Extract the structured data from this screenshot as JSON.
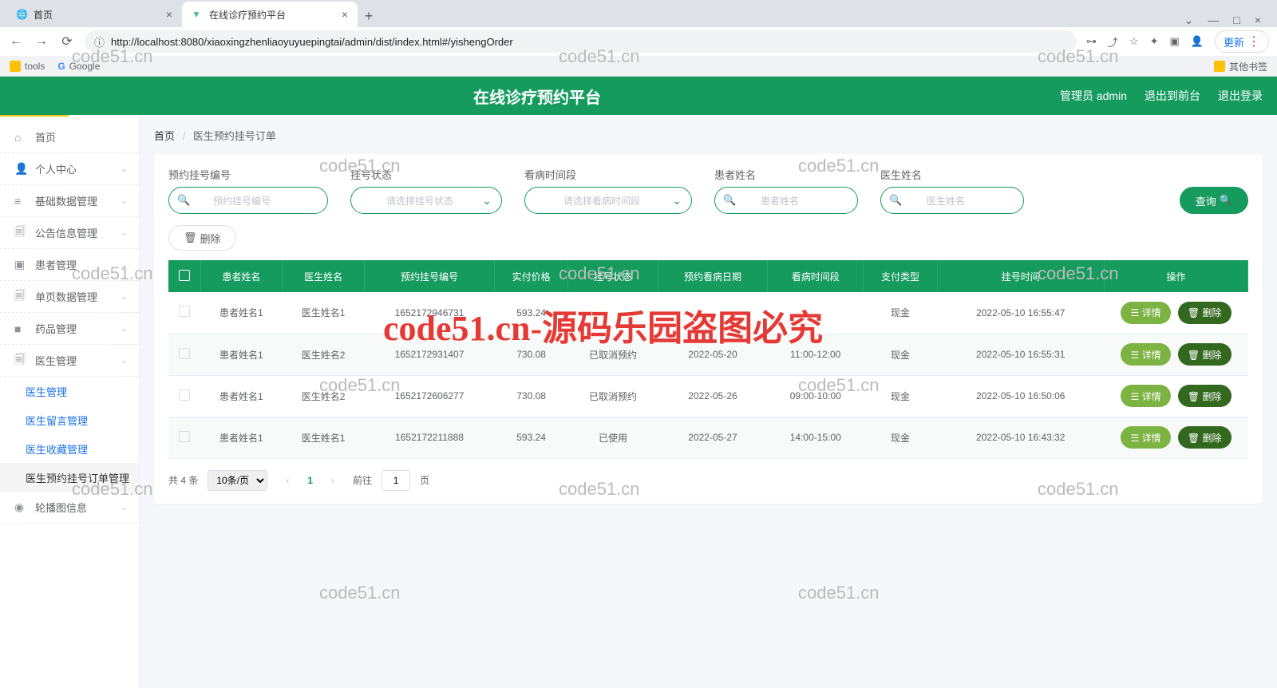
{
  "browser": {
    "tabs": [
      {
        "title": "首页",
        "active": false,
        "favicon": "globe"
      },
      {
        "title": "在线诊疗预约平台",
        "active": true,
        "favicon": "vue"
      }
    ],
    "url": "http://localhost:8080/xiaoxingzhenliaoyuyuepingtai/admin/dist/index.html#/yishengOrder",
    "update_btn": "更新",
    "bookmarks": {
      "tools": "tools",
      "google": "Google",
      "other": "其他书签"
    }
  },
  "header": {
    "title": "在线诊疗预约平台",
    "admin": "管理员 admin",
    "back": "退出到前台",
    "logout": "退出登录"
  },
  "sidebar": {
    "items": [
      {
        "icon": "⌂",
        "label": "首页",
        "chev": false
      },
      {
        "icon": "👤",
        "label": "个人中心",
        "chev": true
      },
      {
        "icon": "≡",
        "label": "基础数据管理",
        "chev": true
      },
      {
        "icon": "🗐",
        "label": "公告信息管理",
        "chev": true
      },
      {
        "icon": "▣",
        "label": "患者管理",
        "chev": true
      },
      {
        "icon": "🗐",
        "label": "单页数据管理",
        "chev": true
      },
      {
        "icon": "■",
        "label": "药品管理",
        "chev": true
      },
      {
        "icon": "🗐",
        "label": "医生管理",
        "chev": true,
        "open": true
      }
    ],
    "subs": [
      {
        "label": "医生管理"
      },
      {
        "label": "医生留言管理"
      },
      {
        "label": "医生收藏管理"
      },
      {
        "label": "医生预约挂号订单管理",
        "active": true
      }
    ],
    "last": {
      "icon": "◉",
      "label": "轮播图信息",
      "chev": true
    }
  },
  "breadcrumb": {
    "home": "首页",
    "current": "医生预约挂号订单"
  },
  "filters": {
    "f1": {
      "label": "预约挂号编号",
      "placeholder": "预约挂号编号"
    },
    "f2": {
      "label": "挂号状态",
      "placeholder": "请选择挂号状态"
    },
    "f3": {
      "label": "看病时间段",
      "placeholder": "请选择看病时间段"
    },
    "f4": {
      "label": "患者姓名",
      "placeholder": "患者姓名"
    },
    "f5": {
      "label": "医生姓名",
      "placeholder": "医生姓名"
    },
    "query": "查询",
    "delete": "删除"
  },
  "table": {
    "headers": [
      "",
      "患者姓名",
      "医生姓名",
      "预约挂号编号",
      "实付价格",
      "挂号状态",
      "预约看病日期",
      "看病时间段",
      "支付类型",
      "挂号时间",
      "操作"
    ],
    "rows": [
      {
        "patient": "患者姓名1",
        "doctor": "医生姓名1",
        "orderno": "1652172946731",
        "price": "593.24",
        "status": "",
        "date": "",
        "slot": "",
        "pay": "现金",
        "time": "2022-05-10 16:55:47"
      },
      {
        "patient": "患者姓名1",
        "doctor": "医生姓名2",
        "orderno": "1652172931407",
        "price": "730.08",
        "status": "已取消预约",
        "date": "2022-05-20",
        "slot": "11:00-12:00",
        "pay": "现金",
        "time": "2022-05-10 16:55:31"
      },
      {
        "patient": "患者姓名1",
        "doctor": "医生姓名2",
        "orderno": "1652172606277",
        "price": "730.08",
        "status": "已取消预约",
        "date": "2022-05-26",
        "slot": "09:00-10:00",
        "pay": "现金",
        "time": "2022-05-10 16:50:06"
      },
      {
        "patient": "患者姓名1",
        "doctor": "医生姓名1",
        "orderno": "1652172211888",
        "price": "593.24",
        "status": "已使用",
        "date": "2022-05-27",
        "slot": "14:00-15:00",
        "pay": "现金",
        "time": "2022-05-10 16:43:32"
      }
    ],
    "action_detail": "详情",
    "action_delete": "删除"
  },
  "pager": {
    "total": "共 4 条",
    "page_size": "10条/页",
    "current": "1",
    "goto_pre": "前往",
    "goto_suf": "页",
    "goto_val": "1"
  },
  "watermark": "code51.cn",
  "big_watermark": "code51.cn-源码乐园盗图必究"
}
